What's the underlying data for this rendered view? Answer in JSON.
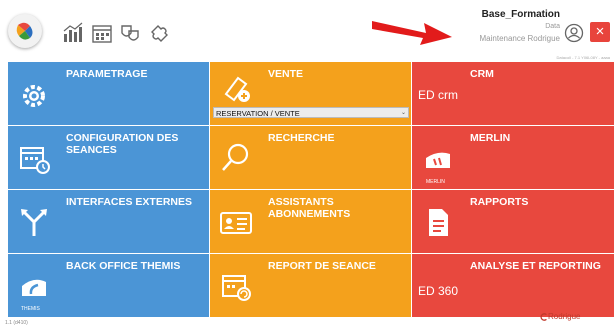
{
  "header": {
    "database_name": "Base_Formation",
    "data_label": "Data",
    "user_name": "Maintenance Rodrigue",
    "note": "Datacoll - 7.1 Y06L08Y - aaaa"
  },
  "toolbar": {
    "icons": [
      "stats-icon",
      "calendar-icon",
      "theater-icon",
      "puzzle-icon"
    ],
    "close_label": "×"
  },
  "tiles": [
    {
      "label": "PARAMETRAGE",
      "color": "blue",
      "icon": "gear-icon"
    },
    {
      "label": "VENTE",
      "color": "orange",
      "icon": "ticket-icon"
    },
    {
      "label": "CRM",
      "color": "red",
      "icon": "ed-crm-icon",
      "icon_text": "ED crm"
    },
    {
      "label": "CONFIGURATION DES SEANCES",
      "color": "blue",
      "icon": "calendar-clock-icon"
    },
    {
      "label": "RECHERCHE",
      "color": "orange",
      "icon": "search-icon"
    },
    {
      "label": "MERLIN",
      "color": "red",
      "icon": "merlin-icon",
      "icon_text": "MERLIN"
    },
    {
      "label": "INTERFACES EXTERNES",
      "color": "blue",
      "icon": "split-arrow-icon"
    },
    {
      "label": "ASSISTANTS ABONNEMENTS",
      "color": "orange",
      "icon": "id-card-icon"
    },
    {
      "label": "RAPPORTS",
      "color": "red",
      "icon": "document-icon"
    },
    {
      "label": "BACK OFFICE THEMIS",
      "color": "blue",
      "icon": "themis-icon",
      "icon_text": "THEMIS"
    },
    {
      "label": "REPORT DE SEANCE",
      "color": "orange",
      "icon": "calendar-refresh-icon"
    },
    {
      "label": "ANALYSE ET REPORTING",
      "color": "red",
      "icon": "ed-360-icon",
      "icon_text": "ED 360"
    }
  ],
  "vente_select": {
    "value": "RESERVATION / VENTE"
  },
  "footer": {
    "version": "1.1 (d410)",
    "brand": "Rodrigue"
  },
  "colors": {
    "blue": "#4b95d6",
    "orange": "#f4a11c",
    "red": "#e8483e",
    "arrow": "#e21b1b"
  }
}
